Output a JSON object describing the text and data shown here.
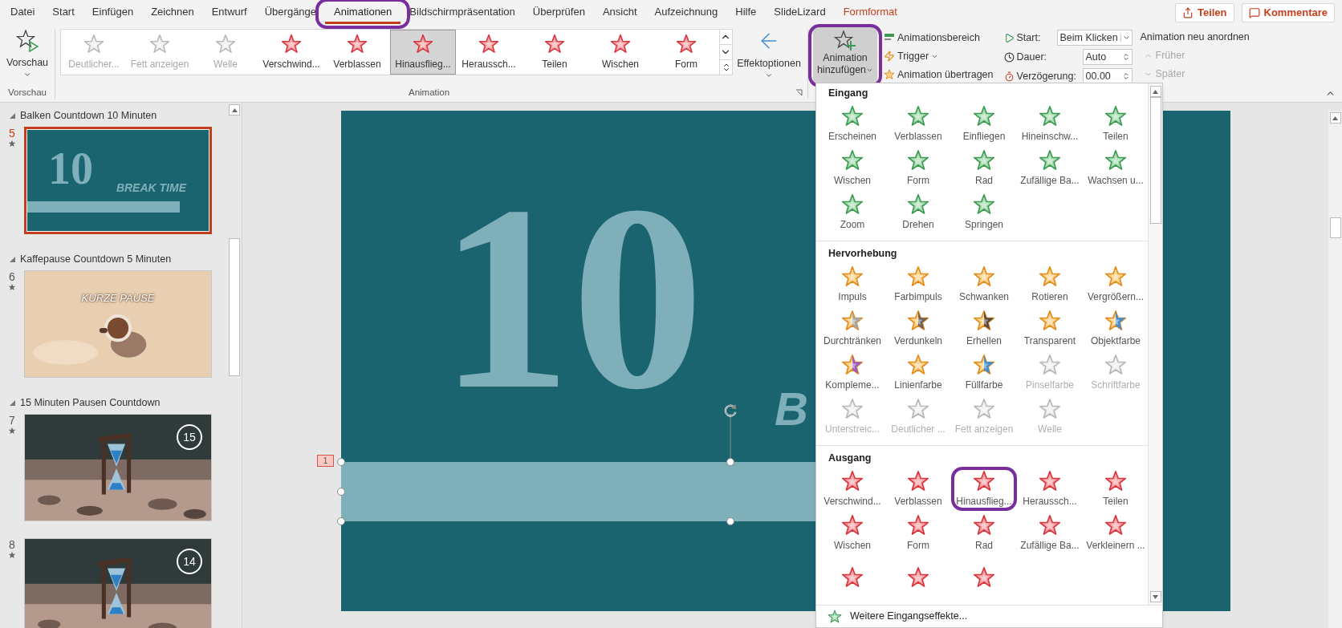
{
  "menu_tabs": [
    {
      "label": "Datei",
      "selected": false,
      "circled": false,
      "kind": "normal"
    },
    {
      "label": "Start",
      "selected": false,
      "circled": false,
      "kind": "normal"
    },
    {
      "label": "Einfügen",
      "selected": false,
      "circled": false,
      "kind": "normal"
    },
    {
      "label": "Zeichnen",
      "selected": false,
      "circled": false,
      "kind": "normal"
    },
    {
      "label": "Entwurf",
      "selected": false,
      "circled": false,
      "kind": "normal"
    },
    {
      "label": "Übergänge",
      "selected": false,
      "circled": false,
      "kind": "normal"
    },
    {
      "label": "Animationen",
      "selected": true,
      "circled": true,
      "kind": "normal"
    },
    {
      "label": "Bildschirmpräsentation",
      "selected": false,
      "circled": false,
      "kind": "normal"
    },
    {
      "label": "Überprüfen",
      "selected": false,
      "circled": false,
      "kind": "normal"
    },
    {
      "label": "Ansicht",
      "selected": false,
      "circled": false,
      "kind": "normal"
    },
    {
      "label": "Aufzeichnung",
      "selected": false,
      "circled": false,
      "kind": "normal"
    },
    {
      "label": "Hilfe",
      "selected": false,
      "circled": false,
      "kind": "normal"
    },
    {
      "label": "SlideLizard",
      "selected": false,
      "circled": false,
      "kind": "normal"
    },
    {
      "label": "Formformat",
      "selected": false,
      "circled": false,
      "kind": "contextual"
    }
  ],
  "top_buttons": [
    {
      "label": "Teilen",
      "kind": "share"
    },
    {
      "label": "Kommentare",
      "kind": "comment"
    }
  ],
  "ribbon": {
    "preview": {
      "label": "Vorschau",
      "group_label": "Vorschau"
    },
    "gallery": {
      "group_label": "Animation",
      "items": [
        {
          "label": "Deutlicher...",
          "disabled": true,
          "selected": false
        },
        {
          "label": "Fett anzeigen",
          "disabled": true,
          "selected": false
        },
        {
          "label": "Welle",
          "disabled": true,
          "selected": false
        },
        {
          "label": "Verschwind...",
          "disabled": false,
          "selected": false
        },
        {
          "label": "Verblassen",
          "disabled": false,
          "selected": false
        },
        {
          "label": "Hinausflieg...",
          "disabled": false,
          "selected": true
        },
        {
          "label": "Heraussch...",
          "disabled": false,
          "selected": false
        },
        {
          "label": "Teilen",
          "disabled": false,
          "selected": false
        },
        {
          "label": "Wischen",
          "disabled": false,
          "selected": false
        },
        {
          "label": "Form",
          "disabled": false,
          "selected": false
        }
      ]
    },
    "effect_options": "Effektoptionen",
    "add_animation": {
      "line1": "Animation",
      "line2": "hinzufügen",
      "expanded": true,
      "circled": true
    },
    "advanced": [
      {
        "label": "Animationsbereich",
        "kind": "pane"
      },
      {
        "label": "Trigger",
        "kind": "trigger"
      },
      {
        "label": "Animation übertragen",
        "kind": "painter"
      }
    ],
    "timing": [
      {
        "label": "Start:",
        "value": "Beim Klicken",
        "kind": "dropdown"
      },
      {
        "label": "Dauer:",
        "value": "Auto",
        "kind": "spinner"
      },
      {
        "label": "Verzögerung:",
        "value": "00.00",
        "kind": "spinner"
      }
    ],
    "reorder": {
      "title": "Animation neu anordnen",
      "items": [
        {
          "label": "Früher",
          "disabled": true,
          "kind": "up"
        },
        {
          "label": "Später",
          "disabled": true,
          "kind": "down"
        }
      ]
    }
  },
  "slide_panel": {
    "sections": [
      {
        "title": "Balken Countdown 10 Minuten",
        "slides": [
          {
            "number": "5",
            "selected": true,
            "animated": true,
            "kind": "bar",
            "big_text": "10",
            "subtitle": "BREAK TIME"
          }
        ]
      },
      {
        "title": "Kaffepause Countdown 5 Minuten",
        "slides": [
          {
            "number": "6",
            "selected": false,
            "animated": true,
            "kind": "coffee",
            "subtitle": "KURZE PAUSE"
          }
        ]
      },
      {
        "title": "15 Minuten Pausen Countdown",
        "slides": [
          {
            "number": "7",
            "selected": false,
            "animated": true,
            "kind": "hourglass",
            "badge": "15"
          },
          {
            "number": "8",
            "selected": false,
            "animated": true,
            "kind": "hourglass",
            "badge": "14"
          }
        ]
      }
    ]
  },
  "slide": {
    "big_text": "10",
    "side_text": "B",
    "tag": "1"
  },
  "animation_menu": {
    "sections": [
      {
        "title": "Eingang",
        "kind": "entrance",
        "items": [
          {
            "label": "Erscheinen",
            "disabled": false,
            "circled": false
          },
          {
            "label": "Verblassen",
            "disabled": false,
            "circled": false
          },
          {
            "label": "Einfliegen",
            "disabled": false,
            "circled": false
          },
          {
            "label": "Hineinschw...",
            "disabled": false,
            "circled": false
          },
          {
            "label": "Teilen",
            "disabled": false,
            "circled": false
          },
          {
            "label": "Wischen",
            "disabled": false,
            "circled": false
          },
          {
            "label": "Form",
            "disabled": false,
            "circled": false
          },
          {
            "label": "Rad",
            "disabled": false,
            "circled": false
          },
          {
            "label": "Zufällige Ba...",
            "disabled": false,
            "circled": false
          },
          {
            "label": "Wachsen u...",
            "disabled": false,
            "circled": false
          },
          {
            "label": "Zoom",
            "disabled": false,
            "circled": false
          },
          {
            "label": "Drehen",
            "disabled": false,
            "circled": false
          },
          {
            "label": "Springen",
            "disabled": false,
            "circled": false
          }
        ]
      },
      {
        "title": "Hervorhebung",
        "kind": "emphasis",
        "items": [
          {
            "label": "Impuls",
            "disabled": false,
            "circled": false
          },
          {
            "label": "Farbimpuls",
            "disabled": false,
            "circled": false
          },
          {
            "label": "Schwanken",
            "disabled": false,
            "circled": false
          },
          {
            "label": "Rotieren",
            "disabled": false,
            "circled": false
          },
          {
            "label": "Vergrößern...",
            "disabled": false,
            "circled": false
          },
          {
            "label": "Durchtränken",
            "disabled": false,
            "circled": false,
            "color": "#a6a6a6"
          },
          {
            "label": "Verdunkeln",
            "disabled": false,
            "circled": false,
            "color": "#6b6158"
          },
          {
            "label": "Erhellen",
            "disabled": false,
            "circled": false,
            "color": "#5b4a3e"
          },
          {
            "label": "Transparent",
            "disabled": false,
            "circled": false
          },
          {
            "label": "Objektfarbe",
            "disabled": false,
            "circled": false,
            "color": "#3f8fd2"
          },
          {
            "label": "Kompleme...",
            "disabled": false,
            "circled": false,
            "color": "#a05cc0"
          },
          {
            "label": "Linienfarbe",
            "disabled": false,
            "circled": false
          },
          {
            "label": "Füllfarbe",
            "disabled": false,
            "circled": false,
            "color": "#3f8fd2"
          },
          {
            "label": "Pinselfarbe",
            "disabled": true,
            "circled": false
          },
          {
            "label": "Schriftfarbe",
            "disabled": true,
            "circled": false
          },
          {
            "label": "Unterstreic...",
            "disabled": true,
            "circled": false
          },
          {
            "label": "Deutlicher ...",
            "disabled": true,
            "circled": false
          },
          {
            "label": "Fett anzeigen",
            "disabled": true,
            "circled": false
          },
          {
            "label": "Welle",
            "disabled": true,
            "circled": false
          }
        ]
      },
      {
        "title": "Ausgang",
        "kind": "exit",
        "items": [
          {
            "label": "Verschwind...",
            "disabled": false,
            "circled": false
          },
          {
            "label": "Verblassen",
            "disabled": false,
            "circled": false
          },
          {
            "label": "Hinausflieg...",
            "disabled": false,
            "circled": true
          },
          {
            "label": "Heraussch...",
            "disabled": false,
            "circled": false
          },
          {
            "label": "Teilen",
            "disabled": false,
            "circled": false
          },
          {
            "label": "Wischen",
            "disabled": false,
            "circled": false
          },
          {
            "label": "Form",
            "disabled": false,
            "circled": false
          },
          {
            "label": "Rad",
            "disabled": false,
            "circled": false
          },
          {
            "label": "Zufällige Ba...",
            "disabled": false,
            "circled": false
          },
          {
            "label": "Verkleinern ...",
            "disabled": false,
            "circled": false
          },
          {
            "disabled": false,
            "circled": false
          },
          {
            "disabled": false,
            "circled": false
          },
          {
            "disabled": false,
            "circled": false
          }
        ]
      }
    ],
    "footer": "Weitere Eingangseffekte..."
  }
}
